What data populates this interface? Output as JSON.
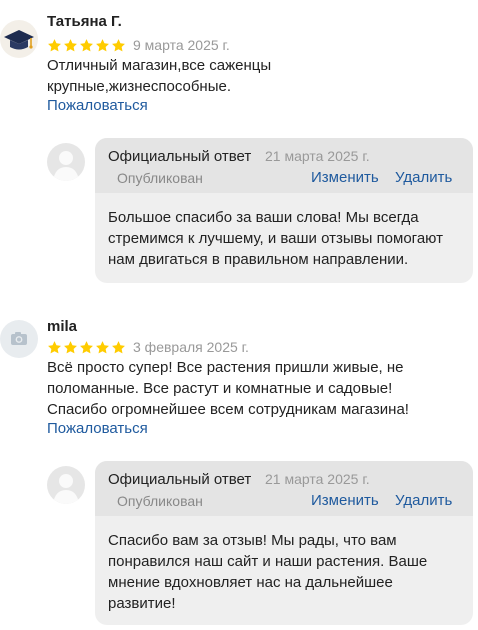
{
  "reviews": [
    {
      "author": "Татьяна Г.",
      "avatar_icon": "graduation-cap-icon",
      "rating": 5,
      "date": "9 марта 2025 г.",
      "lines": [
        "Отличный магазин,все саженцы",
        "крупные,жизнеспособные."
      ],
      "complain_label": "Пожаловаться",
      "reply": {
        "title": "Официальный ответ",
        "date": "21 марта 2025 г.",
        "status": "Опубликован",
        "edit_label": "Изменить",
        "delete_label": "Удалить",
        "lines": [
          "Большое спасибо за ваши слова! Мы всегда",
          "стремимся к лучшему, и ваши отзывы помогают",
          "нам двигаться в правильном направлении."
        ]
      }
    },
    {
      "author": "mila",
      "avatar_icon": "camera-icon",
      "rating": 5,
      "date": "3 февраля 2025 г.",
      "lines": [
        "Всё просто супер! Все растения пришли живые, не",
        "поломанные. Все растут и комнатные и садовые!",
        "Спасибо огромнейшее всем сотрудникам магазина!"
      ],
      "complain_label": "Пожаловаться",
      "reply": {
        "title": "Официальный ответ",
        "date": "21 марта 2025 г.",
        "status": "Опубликован",
        "edit_label": "Изменить",
        "delete_label": "Удалить",
        "lines": [
          "Спасибо вам за отзыв! Мы рады, что вам",
          "понравился наш сайт и наши растения. Ваше",
          "мнение вдохновляет нас на дальнейшее",
          "развитие!"
        ]
      }
    }
  ],
  "colors": {
    "star": "#ffcc00",
    "link": "#1f5a9e",
    "reply_bg": "#efefef",
    "reply_head_bg": "#e4e4e4"
  }
}
